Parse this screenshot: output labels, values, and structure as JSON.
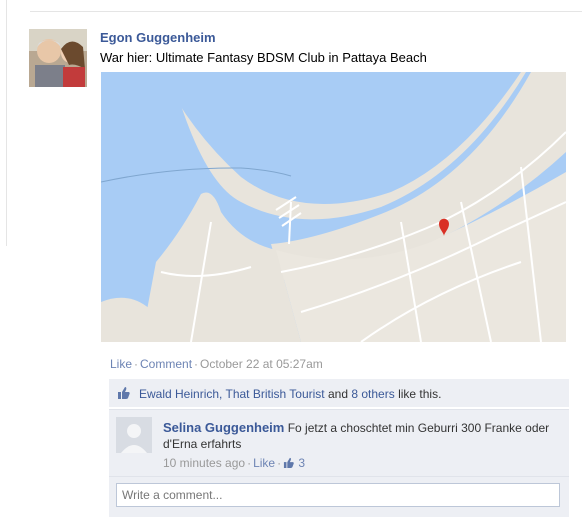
{
  "post": {
    "author": "Egon Guggenheim",
    "text": "War hier: Ultimate Fantasy BDSM Club in Pattaya Beach",
    "actions": {
      "like": "Like",
      "comment": "Comment",
      "timestamp": "October 22 at 05:27am"
    }
  },
  "likes": {
    "names": "Ewald Heinrich, That British Tourist",
    "and": "and",
    "others": "8 others",
    "suffix": "like this."
  },
  "comment": {
    "author": "Selina Guggenheim",
    "text": "Fo jetzt a choschtet min Geburri 300 Franke oder d'Erna erfahrts",
    "time": "10 minutes ago",
    "like": "Like",
    "like_count": "3"
  },
  "composer": {
    "placeholder": "Write a comment..."
  },
  "colors": {
    "link": "#3b5998",
    "panel": "#edeff4",
    "water": "#a3ccff",
    "land": "#e9e5dc"
  }
}
